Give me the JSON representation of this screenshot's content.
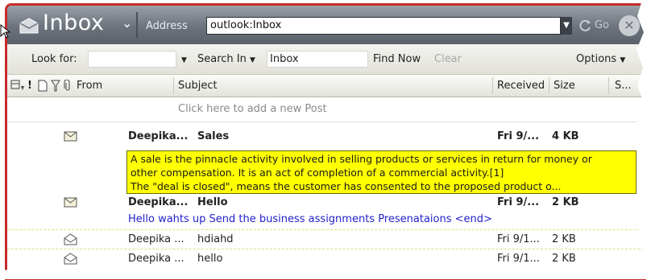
{
  "window": {
    "title": "Inbox",
    "address_label": "Address",
    "address_value": "outlook:Inbox",
    "go_label": "Go"
  },
  "findbar": {
    "look_for_label": "Look for:",
    "look_for_value": "",
    "search_in_label": "Search In",
    "search_in_value": "Inbox",
    "find_now_label": "Find Now",
    "clear_label": "Clear",
    "options_label": "Options"
  },
  "columns": {
    "from": "From",
    "subject": "Subject",
    "received": "Received",
    "size": "Size",
    "extra": "S..."
  },
  "new_post_placeholder": "Click here to add a new Post",
  "messages": [
    {
      "icon": "envelope-closed-icon",
      "from": "Deepika...",
      "subject": "Sales",
      "received": "Fri 9/...",
      "size": "4 KB",
      "unread": true
    },
    {
      "icon": "envelope-closed-icon",
      "from": "Deepika...",
      "subject": "Hello",
      "received": "Fri 9/...",
      "size": "2 KB",
      "unread": true,
      "preview": "Hello wahts up Send the business assignments Presenataions <end>"
    },
    {
      "icon": "envelope-open-icon",
      "from": "Deepika ...",
      "subject": "hdiahd",
      "received": "Fri 9/1...",
      "size": "2 KB",
      "unread": false
    },
    {
      "icon": "envelope-open-icon",
      "from": "Deepika ...",
      "subject": "hello",
      "received": "Fri 9/1...",
      "size": "2 KB",
      "unread": false
    }
  ],
  "tooltip": {
    "line1": "A sale is the pinnacle activity involved in selling products or services in return for money or",
    "line2": "other compensation. It is an act of completion of a commercial activity.[1]",
    "line3": "The \"deal is closed\", means the customer has consented to the proposed product o..."
  },
  "colors": {
    "frame_border": "#c62a2a",
    "tooltip_bg": "#ffff00",
    "preview_text": "#2222cc"
  }
}
